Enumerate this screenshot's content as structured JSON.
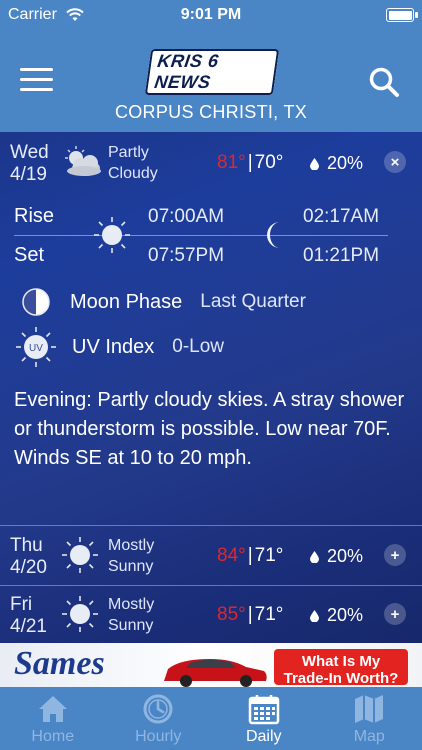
{
  "status": {
    "carrier": "Carrier",
    "time": "9:01 PM"
  },
  "header": {
    "logo": "KRIS 6 NEWS",
    "location": "CORPUS CHRISTI, TX"
  },
  "today": {
    "day": "Wed",
    "date": "4/19",
    "condition_line1": "Partly",
    "condition_line2": "Cloudy",
    "hi": "81°",
    "lo": "70°",
    "precip": "20%",
    "toggle": "×",
    "rise_label": "Rise",
    "set_label": "Set",
    "sunrise": "07:00AM",
    "sunset": "07:57PM",
    "moonrise": "02:17AM",
    "moonset": "01:21PM",
    "moon_phase_label": "Moon Phase",
    "moon_phase_value": "Last Quarter",
    "uv_label": "UV Index",
    "uv_value": "0-Low",
    "uv_badge": "UV",
    "description": "Evening: Partly cloudy skies. A stray shower or thunderstorm is possible. Low near 70F. Winds SE at 10 to 20 mph."
  },
  "forecast": [
    {
      "day": "Thu",
      "date": "4/20",
      "condition_line1": "Mostly",
      "condition_line2": "Sunny",
      "hi": "84°",
      "lo": "71°",
      "precip": "20%",
      "toggle": "+"
    },
    {
      "day": "Fri",
      "date": "4/21",
      "condition_line1": "Mostly",
      "condition_line2": "Sunny",
      "hi": "85°",
      "lo": "71°",
      "precip": "20%",
      "toggle": "+"
    }
  ],
  "ad": {
    "brand": "Sames",
    "cta_line1": "What Is My",
    "cta_line2": "Trade-In Worth?"
  },
  "tabs": [
    {
      "label": "Home",
      "icon": "home-icon"
    },
    {
      "label": "Hourly",
      "icon": "clock-icon"
    },
    {
      "label": "Daily",
      "icon": "calendar-icon"
    },
    {
      "label": "Map",
      "icon": "map-icon"
    }
  ],
  "colors": {
    "bar_blue": "#4a86c6",
    "hi_temp_red": "#e0262e",
    "tab_inactive": "#8fb6e1"
  }
}
